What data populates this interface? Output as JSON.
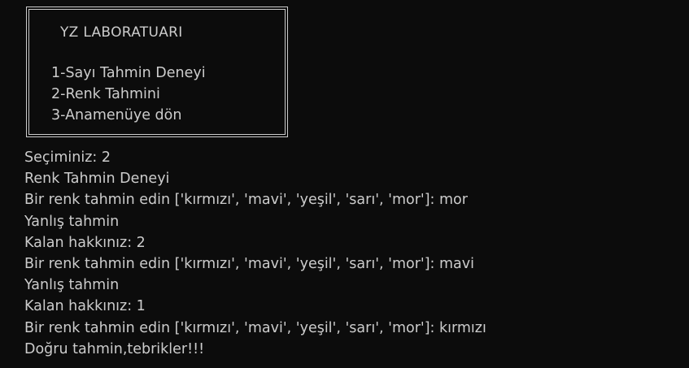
{
  "menu": {
    "title": "YZ LABORATUARI",
    "options": [
      "1-Sayı Tahmin Deneyi",
      "2-Renk Tahmini",
      "3-Anamenüye dön"
    ]
  },
  "output_lines": [
    "Seçiminiz: 2",
    "Renk Tahmin Deneyi",
    "Bir renk tahmin edin ['kırmızı', 'mavi', 'yeşil', 'sarı', 'mor']: mor",
    "Yanlış tahmin",
    "Kalan hakkınız: 2",
    "Bir renk tahmin edin ['kırmızı', 'mavi', 'yeşil', 'sarı', 'mor']: mavi",
    "Yanlış tahmin",
    "Kalan hakkınız: 1",
    "Bir renk tahmin edin ['kırmızı', 'mavi', 'yeşil', 'sarı', 'mor']: kırmızı",
    "Doğru tahmin,tebrikler!!!"
  ],
  "colors": {
    "background": "#0c0c0c",
    "text": "#cccccc"
  }
}
